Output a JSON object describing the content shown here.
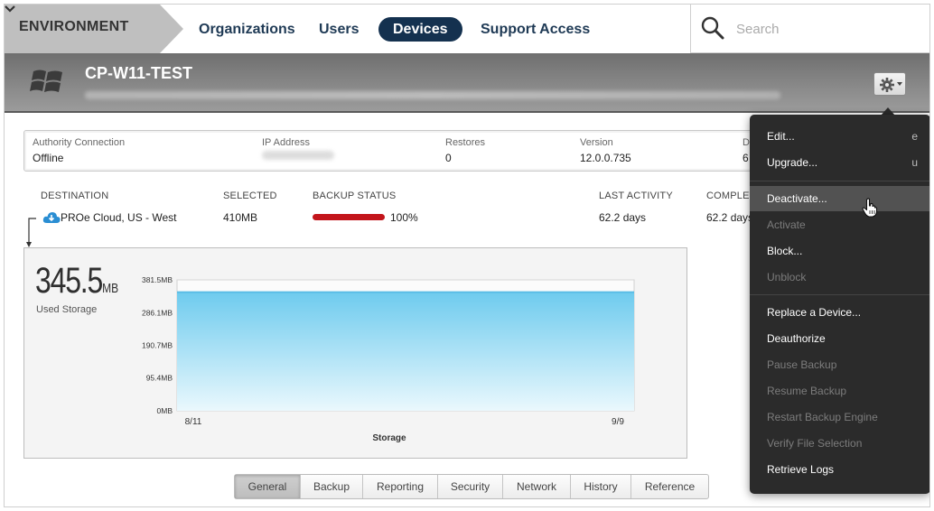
{
  "nav": {
    "environment_label": "ENVIRONMENT",
    "items": [
      {
        "label": "Organizations",
        "active": false
      },
      {
        "label": "Users",
        "active": false
      },
      {
        "label": "Devices",
        "active": true
      },
      {
        "label": "Support Access",
        "active": false
      }
    ],
    "search_placeholder": "Search"
  },
  "device": {
    "name": "CP-W11-TEST",
    "os_icon": "windows-icon"
  },
  "info": {
    "authority_label": "Authority Connection",
    "authority_value": "Offline",
    "ip_label": "IP Address",
    "restores_label": "Restores",
    "restores_value": "0",
    "version_label": "Version",
    "version_value": "12.0.0.735",
    "extra_label": "D",
    "extra_value": "6"
  },
  "destination_table": {
    "headers": {
      "destination": "DESTINATION",
      "selected": "SELECTED",
      "backup_status": "BACKUP STATUS",
      "last_activity": "LAST ACTIVITY",
      "completed": "COMPLET"
    },
    "row": {
      "destination": "PROe Cloud, US - West",
      "selected": "410MB",
      "backup_percent": "100%",
      "backup_fraction": 1.0,
      "last_activity": "62.2 days",
      "completed": "62.2 days"
    }
  },
  "storage": {
    "value": "345.5",
    "unit": "MB",
    "label": "Used Storage"
  },
  "chart_data": {
    "type": "area",
    "xlabel": "Storage",
    "ylabel": "",
    "x": [
      "8/11",
      "9/9"
    ],
    "y_ticks": [
      "381.5MB",
      "286.1MB",
      "190.7MB",
      "95.4MB",
      "0MB"
    ],
    "y_tick_values": [
      381.5,
      286.1,
      190.7,
      95.4,
      0
    ],
    "ylim": [
      0,
      381.5
    ],
    "series": [
      {
        "values": [
          345.5,
          345.5
        ]
      }
    ],
    "grid": true,
    "colors": {
      "fill_top": "#6ecbee",
      "fill_bottom": "#eaf8fd",
      "line": "#5bbde6"
    }
  },
  "tabs": [
    {
      "label": "General",
      "active": true
    },
    {
      "label": "Backup",
      "active": false
    },
    {
      "label": "Reporting",
      "active": false
    },
    {
      "label": "Security",
      "active": false
    },
    {
      "label": "Network",
      "active": false
    },
    {
      "label": "History",
      "active": false
    },
    {
      "label": "Reference",
      "active": false
    }
  ],
  "menu": {
    "items": [
      {
        "label": "Edit...",
        "key": "e",
        "disabled": false
      },
      {
        "label": "Upgrade...",
        "key": "u",
        "disabled": false
      },
      {
        "label": "Deactivate...",
        "key": "",
        "disabled": false,
        "hover": true
      },
      {
        "label": "Activate",
        "key": "",
        "disabled": true
      },
      {
        "label": "Block...",
        "key": "",
        "disabled": false
      },
      {
        "label": "Unblock",
        "key": "",
        "disabled": true
      },
      {
        "label": "Replace a Device...",
        "key": "",
        "disabled": false
      },
      {
        "label": "Deauthorize",
        "key": "",
        "disabled": false
      },
      {
        "label": "Pause Backup",
        "key": "",
        "disabled": true
      },
      {
        "label": "Resume Backup",
        "key": "",
        "disabled": true
      },
      {
        "label": "Restart Backup Engine",
        "key": "",
        "disabled": true
      },
      {
        "label": "Verify File Selection",
        "key": "",
        "disabled": true
      },
      {
        "label": "Retrieve Logs",
        "key": "",
        "disabled": false
      }
    ]
  },
  "colors": {
    "nav_active": "#14314f",
    "progress": "#c3151b",
    "menu_bg": "#2b2b2b"
  }
}
